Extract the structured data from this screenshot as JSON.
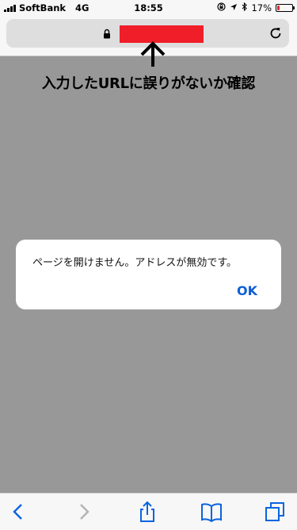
{
  "status_bar": {
    "carrier": "SoftBank",
    "network": "4G",
    "time": "18:55",
    "battery_percent": "17%",
    "battery_level": 0.17,
    "battery_color": "#e8282c"
  },
  "browser": {
    "url_redacted_color": "#f01e28",
    "icons": [
      "lock-icon",
      "reload-icon"
    ]
  },
  "annotation": {
    "text": "入力したURLに誤りがないか確認",
    "icon": "up-arrow-icon"
  },
  "alert": {
    "message": "ページを開けません。アドレスが無効です。",
    "ok_label": "OK",
    "ok_color": "#0f5ed7"
  },
  "toolbar": {
    "icons": [
      "back-icon",
      "forward-icon",
      "share-icon",
      "bookmarks-icon",
      "tabs-icon"
    ],
    "accent_color": "#0a63e0"
  }
}
